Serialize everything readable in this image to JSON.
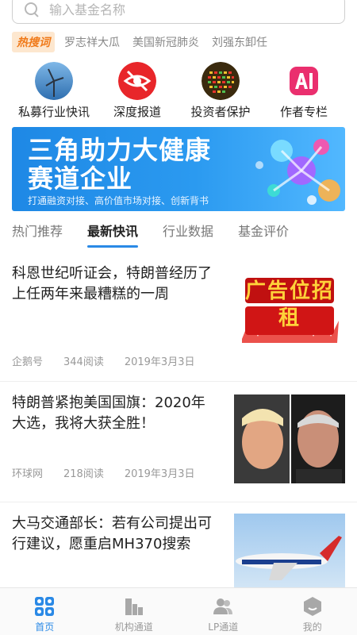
{
  "search": {
    "placeholder": "输入基金名称"
  },
  "hot": {
    "badge": "热搜词",
    "items": [
      "罗志祥大瓜",
      "美国新冠肺炎",
      "刘强东卸任"
    ]
  },
  "quick": [
    {
      "label": "私募行业快讯",
      "icon": "windmill-icon"
    },
    {
      "label": "深度报道",
      "icon": "eye-icon"
    },
    {
      "label": "投资者保护",
      "icon": "stock-board-icon"
    },
    {
      "label": "作者专栏",
      "icon": "ai-icon"
    }
  ],
  "banner": {
    "line1": "三角助力大健康",
    "line2": "赛道企业",
    "sub": "打通融资对接、高价值市场对接、创新背书"
  },
  "tabs": [
    "热门推荐",
    "最新快讯",
    "行业数据",
    "基金评价"
  ],
  "news": [
    {
      "title": "科恩世纪听证会，特朗普经历了上任两年来最糟糕的一周",
      "source": "企鹅号",
      "reads": "344阅读",
      "date": "2019年3月3日",
      "thumb_text": "广告位招租"
    },
    {
      "title": "特朗普紧抱美国国旗：2020年大选，我将大获全胜！",
      "source": "环球网",
      "reads": "218阅读",
      "date": "2019年3月3日"
    },
    {
      "title": "大马交通部长：若有公司提出可行建议，愿重启MH370搜索",
      "source": "",
      "reads": "",
      "date": ""
    }
  ],
  "nav": [
    "首页",
    "机构通道",
    "LP通道",
    "我的"
  ],
  "colors": {
    "accent": "#2a89e6",
    "hot": "#f07a1a",
    "banner": "#1e88e5"
  }
}
